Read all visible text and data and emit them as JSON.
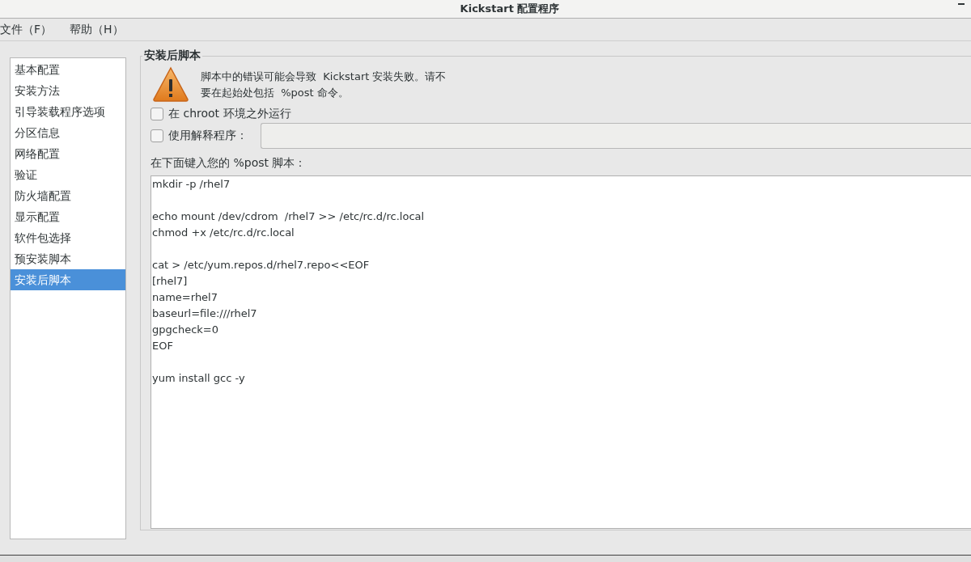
{
  "window": {
    "title": "Kickstart 配置程序"
  },
  "menu": [
    {
      "label": "文件（F）"
    },
    {
      "label": "帮助（H）"
    }
  ],
  "sidebar": {
    "items": [
      {
        "label": "基本配置",
        "selected": false
      },
      {
        "label": "安装方法",
        "selected": false
      },
      {
        "label": "引导装载程序选项",
        "selected": false
      },
      {
        "label": "分区信息",
        "selected": false
      },
      {
        "label": "网络配置",
        "selected": false
      },
      {
        "label": "验证",
        "selected": false
      },
      {
        "label": "防火墙配置",
        "selected": false
      },
      {
        "label": "显示配置",
        "selected": false
      },
      {
        "label": "软件包选择",
        "selected": false
      },
      {
        "label": "预安装脚本",
        "selected": false
      },
      {
        "label": "安装后脚本",
        "selected": true
      }
    ]
  },
  "panel": {
    "title": "安装后脚本",
    "warning": [
      "脚本中的错误可能会导致  Kickstart 安装失败。请不",
      "要在起始处包括  %post 命令。"
    ],
    "chroot_option": {
      "label": "在  chroot 环境之外运行",
      "checked": false
    },
    "interpreter_option": {
      "label": "使用解释程序：",
      "checked": false
    },
    "script_label": "在下面键入您的  %post 脚本：",
    "script_blocks": [
      [
        "mkdir -p /rhel7"
      ],
      [
        "echo mount /dev/cdrom  /rhel7 >> /etc/rc.d/rc.local",
        "chmod +x /etc/rc.d/rc.local"
      ],
      [
        "cat > /etc/yum.repos.d/rhel7.repo<<EOF",
        "[rhel7]",
        "name=rhel7",
        "baseurl=file:///rhel7",
        "gpgcheck=0",
        "EOF"
      ],
      [
        "yum install gcc -y"
      ]
    ]
  }
}
